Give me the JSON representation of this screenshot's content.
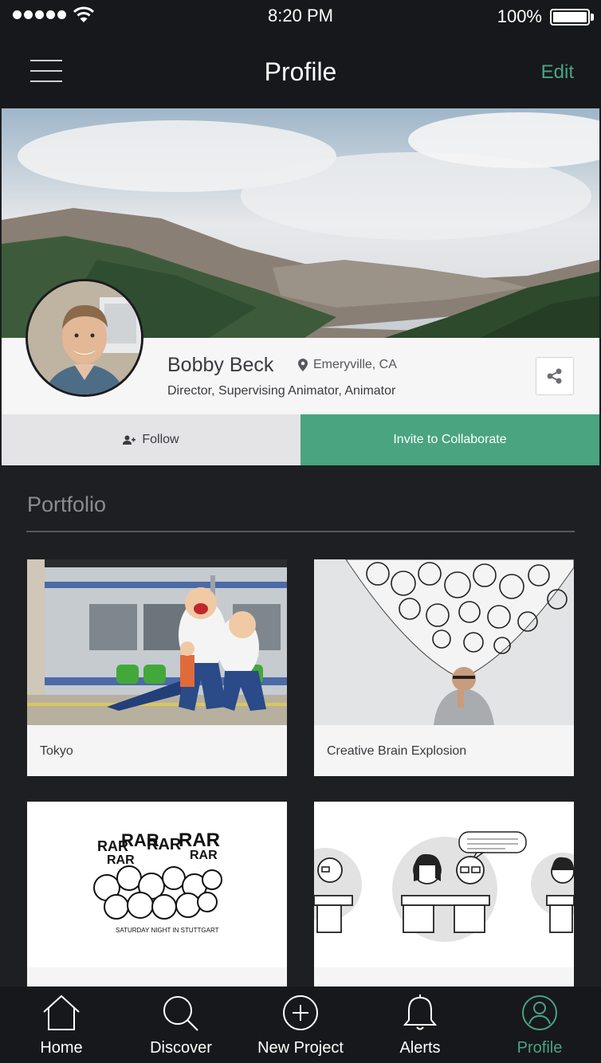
{
  "status": {
    "time": "8:20 PM",
    "battery": "100%"
  },
  "nav": {
    "title": "Profile",
    "edit_label": "Edit"
  },
  "profile": {
    "name": "Bobby Beck",
    "location": "Emeryville, CA",
    "title": "Director, Supervising Animator, Animator"
  },
  "actions": {
    "follow_label": "Follow",
    "invite_label": "Invite to Collaborate"
  },
  "portfolio": {
    "heading": "Portfolio",
    "items": [
      {
        "label": "Tokyo"
      },
      {
        "label": "Creative Brain Explosion"
      },
      {
        "label": ""
      },
      {
        "label": ""
      }
    ],
    "comic_caption": "SATURDAY NIGHT IN STUTTGART",
    "comic_word": "RAR"
  },
  "tabs": [
    {
      "label": "Home",
      "icon": "home-icon"
    },
    {
      "label": "Discover",
      "icon": "search-icon"
    },
    {
      "label": "New Project",
      "icon": "plus-circle-icon"
    },
    {
      "label": "Alerts",
      "icon": "bell-icon"
    },
    {
      "label": "Profile",
      "icon": "user-circle-icon",
      "active": true
    }
  ],
  "colors": {
    "accent": "#49a47f",
    "dark": "#17181b",
    "panel": "#1e1f22"
  }
}
